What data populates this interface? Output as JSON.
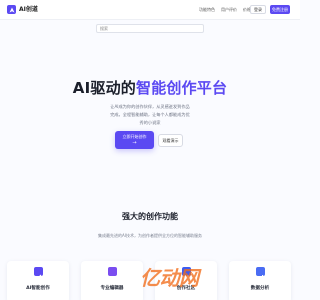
{
  "header": {
    "logo_text": "AI创道",
    "nav": [
      "功能特色",
      "用户评价",
      "价格方案"
    ],
    "login_label": "登录",
    "register_label": "免费注册"
  },
  "search": {
    "placeholder": "搜索"
  },
  "hero": {
    "title_part1": "AI驱动的",
    "title_part2": "智能创作平台",
    "subtitle": "让AI成为你的创作伙伴，从灵感迸发到作品完成，全程智能辅助，让每个人都能成为优秀的小说家",
    "primary_label": "立即开始创作",
    "primary_arrow": "→",
    "demo_label": "观看演示"
  },
  "features": {
    "title": "强大的创作功能",
    "subtitle": "集成最先进的AI技术，为创作者提供全方位的智能辅助服务",
    "cards": [
      {
        "title": "AI智能创作",
        "color": "#5b49f2"
      },
      {
        "title": "专业编辑器",
        "color": "#7a4df0"
      },
      {
        "title": "创作社区",
        "color": "#3e5cf0"
      },
      {
        "title": "数据分析",
        "color": "#4a6cf3"
      }
    ]
  },
  "watermark": {
    "text": "亿动网",
    "color": "#f26d1a"
  }
}
